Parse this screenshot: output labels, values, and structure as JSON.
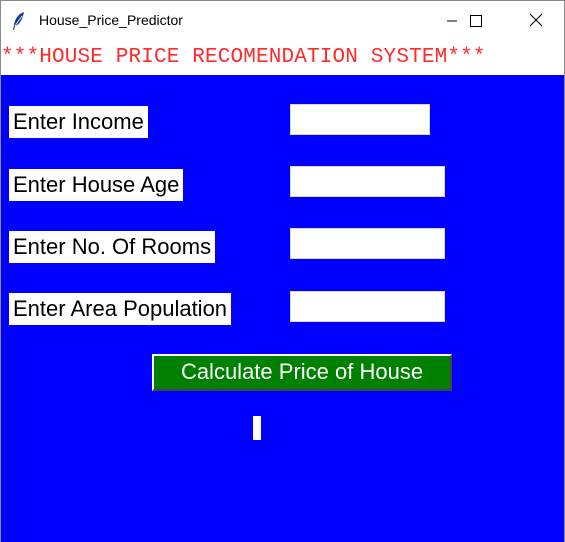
{
  "window": {
    "title": "House_Price_Predictor",
    "icon": "feather-icon",
    "controls": {
      "minimize_icon": "minimize-icon",
      "maximize_icon": "maximize-icon",
      "close_icon": "close-icon"
    }
  },
  "banner": {
    "text": "***HOUSE PRICE RECOMENDATION SYSTEM***",
    "color": "#ff2a2a"
  },
  "form": {
    "background": "#0000ff",
    "fields": [
      {
        "label": "Enter Income",
        "value": ""
      },
      {
        "label": "Enter House Age",
        "value": ""
      },
      {
        "label": "Enter No. Of Rooms",
        "value": ""
      },
      {
        "label": "Enter Area Population",
        "value": ""
      }
    ],
    "submit_label": "Calculate Price of House",
    "submit_color": "#008000",
    "result_text": ""
  }
}
